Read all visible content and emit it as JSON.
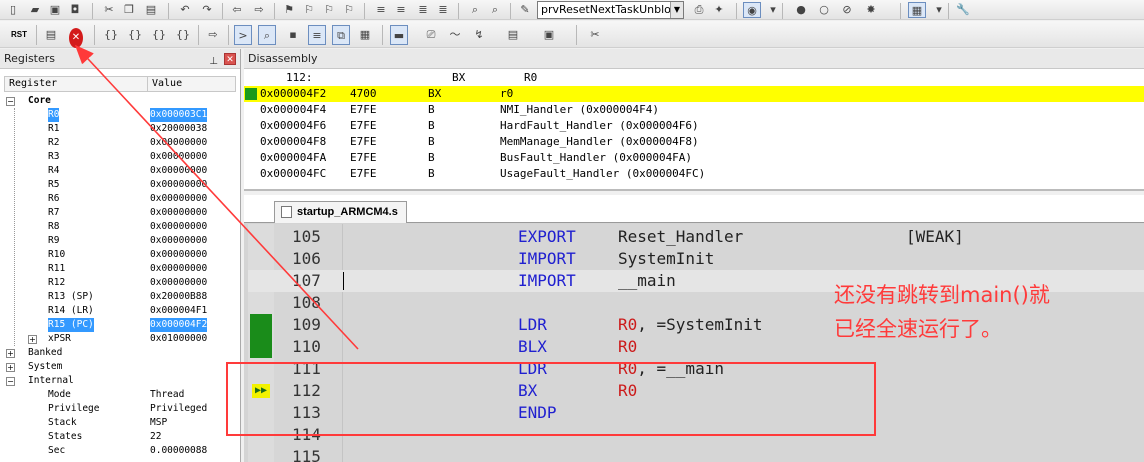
{
  "toolbar1": {
    "function_combo_value": "prvResetNextTaskUnbloc"
  },
  "toolbar2": {
    "reset_label": "RST",
    "reset_tooltip": "Reset"
  },
  "registers": {
    "panel_title": "Registers",
    "col_register": "Register",
    "col_value": "Value",
    "groups": {
      "core": "Core",
      "banked": "Banked",
      "system": "System",
      "internal": "Internal"
    },
    "core": [
      {
        "name": "R0",
        "value": "0x000003C1"
      },
      {
        "name": "R1",
        "value": "0x20000038"
      },
      {
        "name": "R2",
        "value": "0x00000000"
      },
      {
        "name": "R3",
        "value": "0x00000000"
      },
      {
        "name": "R4",
        "value": "0x00000000"
      },
      {
        "name": "R5",
        "value": "0x00000000"
      },
      {
        "name": "R6",
        "value": "0x00000000"
      },
      {
        "name": "R7",
        "value": "0x00000000"
      },
      {
        "name": "R8",
        "value": "0x00000000"
      },
      {
        "name": "R9",
        "value": "0x00000000"
      },
      {
        "name": "R10",
        "value": "0x00000000"
      },
      {
        "name": "R11",
        "value": "0x00000000"
      },
      {
        "name": "R12",
        "value": "0x00000000"
      },
      {
        "name": "R13 (SP)",
        "value": "0x20000B88"
      },
      {
        "name": "R14 (LR)",
        "value": "0x000004F1"
      },
      {
        "name": "R15 (PC)",
        "value": "0x000004F2"
      },
      {
        "name": "xPSR",
        "value": "0x01000000"
      }
    ],
    "internal": [
      {
        "name": "Mode",
        "value": "Thread"
      },
      {
        "name": "Privilege",
        "value": "Privileged"
      },
      {
        "name": "Stack",
        "value": "MSP"
      },
      {
        "name": "States",
        "value": "22"
      },
      {
        "name": "Sec",
        "value": "0.00000088"
      }
    ]
  },
  "disassembly": {
    "panel_title": "Disassembly",
    "header_line": {
      "lineno": "112:",
      "op": "BX",
      "arg": "R0"
    },
    "rows": [
      {
        "addr": "0x000004F2",
        "code": "4700",
        "op": "BX",
        "arg": "r0"
      },
      {
        "addr": "0x000004F4",
        "code": "E7FE",
        "op": "B",
        "arg": "NMI_Handler (0x000004F4)"
      },
      {
        "addr": "0x000004F6",
        "code": "E7FE",
        "op": "B",
        "arg": "HardFault_Handler (0x000004F6)"
      },
      {
        "addr": "0x000004F8",
        "code": "E7FE",
        "op": "B",
        "arg": "MemManage_Handler (0x000004F8)"
      },
      {
        "addr": "0x000004FA",
        "code": "E7FE",
        "op": "B",
        "arg": "BusFault_Handler (0x000004FA)"
      },
      {
        "addr": "0x000004FC",
        "code": "E7FE",
        "op": "B",
        "arg": "UsageFault_Handler (0x000004FC)"
      }
    ]
  },
  "editor": {
    "tab_label": "startup_ARMCM4.s",
    "lines": [
      {
        "no": "105",
        "op": "EXPORT",
        "arg": "Reset_Handler",
        "extra": "[WEAK]"
      },
      {
        "no": "106",
        "op": "IMPORT",
        "arg": "SystemInit",
        "extra": ""
      },
      {
        "no": "107",
        "op": "IMPORT",
        "arg": "__main",
        "extra": ""
      },
      {
        "no": "108",
        "op": "",
        "arg": "",
        "extra": ""
      },
      {
        "no": "109",
        "op": "LDR",
        "arg": "R0, =SystemInit",
        "extra": ""
      },
      {
        "no": "110",
        "op": "BLX",
        "arg": "R0",
        "extra": ""
      },
      {
        "no": "111",
        "op": "LDR",
        "arg": "R0, =__main",
        "extra": ""
      },
      {
        "no": "112",
        "op": "BX",
        "arg": "R0",
        "extra": ""
      },
      {
        "no": "113",
        "op": "ENDP",
        "arg": "",
        "extra": ""
      },
      {
        "no": "114",
        "op": "",
        "arg": "",
        "extra": ""
      },
      {
        "no": "115",
        "op": "",
        "arg": "",
        "extra": ""
      }
    ]
  },
  "annotation": {
    "line1": "还没有跳转到main()就",
    "line2": "已经全速运行了。",
    "color": "#ff3a3a"
  }
}
